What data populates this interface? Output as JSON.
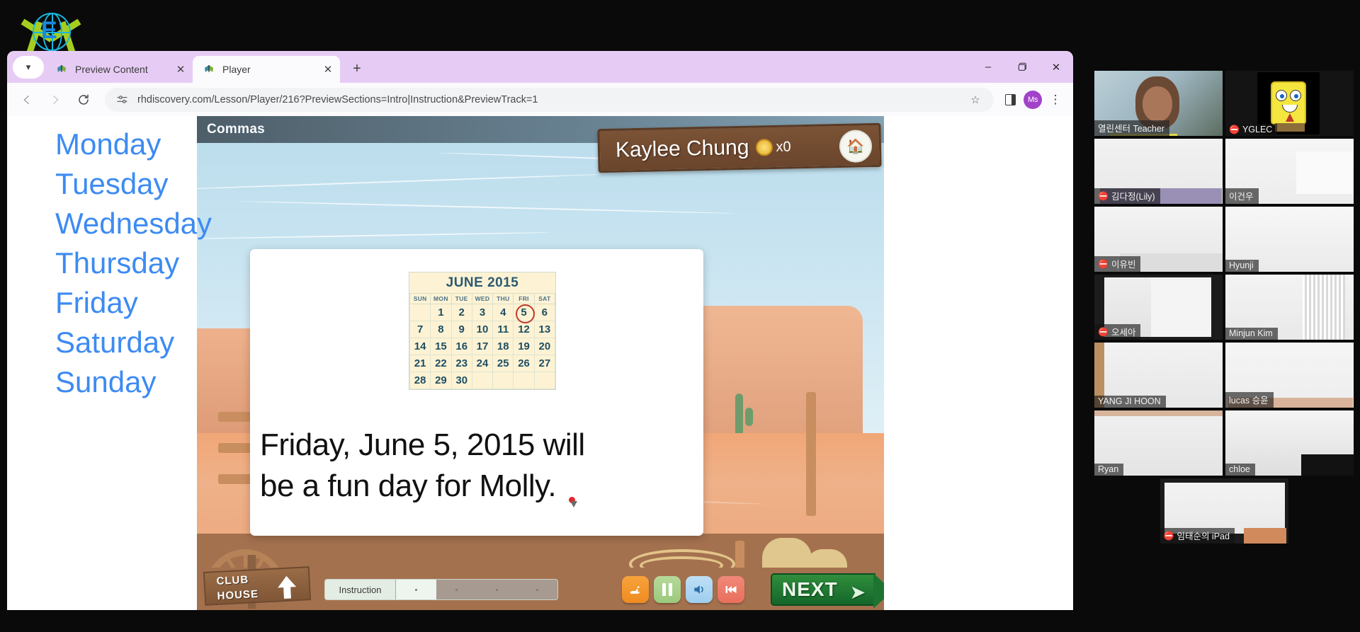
{
  "browser": {
    "tabs": [
      {
        "label": "Preview Content",
        "active": false,
        "favicon": "butterfly-icon"
      },
      {
        "label": "Player",
        "active": true,
        "favicon": "butterfly-icon"
      }
    ],
    "new_tab_label": "+",
    "tab_search_icon": "chevron-down-icon",
    "window_controls": {
      "minimize": "–",
      "maximize": "❐",
      "close": "✕"
    },
    "nav": {
      "back": "←",
      "forward": "→",
      "reload": "↻"
    },
    "omnibox": {
      "url": "rhdiscovery.com/Lesson/Player/216?PreviewSections=Intro|Instruction&PreviewTrack=1",
      "site_info_icon": "tune-icon",
      "bookmark_icon": "star-icon"
    },
    "side_panel_icon": "side-panel-icon",
    "profile_initials": "Ms",
    "menu_icon": "kebab-menu-icon"
  },
  "page": {
    "days_of_week": [
      "Monday",
      "Tuesday",
      "Wednesday",
      "Thursday",
      "Friday",
      "Saturday",
      "Sunday"
    ]
  },
  "lesson": {
    "title": "Commas",
    "player_name": "Kaylee Chung",
    "coin_count": "x0",
    "home_badge_icon": "birdhouse-icon",
    "calendar": {
      "month_title": "JUNE 2015",
      "weekday_headers": [
        "SUN",
        "MON",
        "TUE",
        "WED",
        "THU",
        "FRI",
        "SAT"
      ],
      "weeks": [
        [
          "",
          "1",
          "2",
          "3",
          "4",
          "5",
          "6"
        ],
        [
          "7",
          "8",
          "9",
          "10",
          "11",
          "12",
          "13"
        ],
        [
          "14",
          "15",
          "16",
          "17",
          "18",
          "19",
          "20"
        ],
        [
          "21",
          "22",
          "23",
          "24",
          "25",
          "26",
          "27"
        ],
        [
          "28",
          "29",
          "30",
          "",
          "",
          "",
          ""
        ]
      ],
      "circled_day": "5",
      "circle_color": "#c0392b"
    },
    "sentence_lines": [
      "Friday, June 5, 2015 will",
      "be a fun day for Molly."
    ],
    "toolbar": {
      "clubhouse_line1": "CLUB",
      "clubhouse_line2": "HOUSE",
      "clubhouse_arrow_icon": "arrow-up-icon",
      "progress_label": "Instruction",
      "buttons": [
        {
          "name": "speed-button",
          "icon": "rabbit-icon",
          "color": "#ef8c21"
        },
        {
          "name": "pause-button",
          "icon": "pause-icon",
          "color": "#9cc97d"
        },
        {
          "name": "volume-button",
          "icon": "speaker-icon",
          "color": "#9ecdef"
        },
        {
          "name": "rewind-button",
          "icon": "rewind-icon",
          "color": "#e8705c"
        }
      ],
      "next_label": "NEXT",
      "next_arrow_icon": "arrow-right-icon"
    }
  },
  "gallery": {
    "rows": [
      [
        {
          "name": "열린센터 Teacher",
          "muted": false,
          "teacher": true,
          "kind": "video"
        },
        {
          "name": "YGLEC",
          "muted": true,
          "kind": "spongebob"
        }
      ],
      [
        {
          "name": "김다정(Lily)",
          "muted": true,
          "kind": "video"
        },
        {
          "name": "이건우",
          "muted": false,
          "kind": "video"
        }
      ],
      [
        {
          "name": "이유빈",
          "muted": true,
          "kind": "video"
        },
        {
          "name": "Hyunji",
          "muted": false,
          "kind": "video"
        }
      ],
      [
        {
          "name": "오세아",
          "muted": true,
          "kind": "video"
        },
        {
          "name": "Minjun Kim",
          "muted": false,
          "kind": "video"
        }
      ],
      [
        {
          "name": "YANG JI HOON",
          "muted": false,
          "kind": "video"
        },
        {
          "name": "lucas 승윤",
          "muted": false,
          "kind": "video"
        }
      ],
      [
        {
          "name": "Ryan",
          "muted": false,
          "kind": "video"
        },
        {
          "name": "chloe",
          "muted": false,
          "kind": "video",
          "speaking": true
        }
      ]
    ],
    "last": {
      "name": "임태순의 iPad",
      "muted": true,
      "kind": "video"
    },
    "mute_glyph": "🎙",
    "speaking_border_color": "#9bd428"
  }
}
